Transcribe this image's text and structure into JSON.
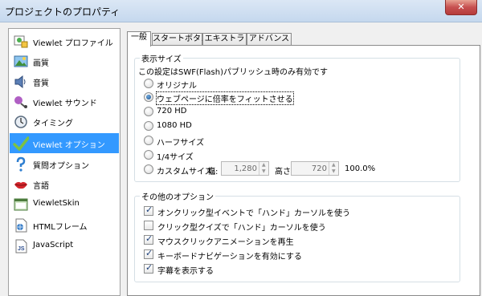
{
  "window": {
    "title": "プロジェクトのプロパティ",
    "close_glyph": "✕"
  },
  "sidebar": {
    "items": [
      {
        "label": "Viewlet プロファイル",
        "icon": "viewlet-profile-icon"
      },
      {
        "label": "画質",
        "icon": "image-quality-icon"
      },
      {
        "label": "音質",
        "icon": "speaker-icon"
      },
      {
        "label": "Viewlet サウンド",
        "icon": "viewlet-sound-icon"
      },
      {
        "label": "タイミング",
        "icon": "clock-icon"
      },
      {
        "label": "Viewlet オプション",
        "icon": "checkmark-icon",
        "selected": true
      },
      {
        "label": "質問オプション",
        "icon": "question-mark-icon"
      },
      {
        "label": "言語",
        "icon": "lips-icon"
      },
      {
        "label": "ViewletSkin",
        "icon": "skin-window-icon"
      },
      {
        "label": "HTMLフレーム",
        "icon": "html-page-icon"
      },
      {
        "label": "JavaScript",
        "icon": "javascript-icon"
      }
    ]
  },
  "tabs": [
    {
      "label": "一般",
      "active": true
    },
    {
      "label": "スタートボタン"
    },
    {
      "label": "エキストラ"
    },
    {
      "label": "アドバンス"
    }
  ],
  "display_size": {
    "legend": "表示サイズ",
    "note": "この設定はSWF(Flash)パブリッシュ時のみ有効です",
    "options": [
      {
        "label": "オリジナル",
        "checked": false
      },
      {
        "label": "ウェブページに倍率をフィットさせる",
        "checked": true
      },
      {
        "label": "720 HD",
        "checked": false
      },
      {
        "label": "1080 HD",
        "checked": false
      },
      {
        "label": "ハーフサイズ",
        "checked": false
      },
      {
        "label": "1/4サイズ",
        "checked": false
      },
      {
        "label": "カスタムサイズ:",
        "checked": false
      }
    ],
    "width_label": "幅:",
    "width_value": "1,280",
    "height_label": "高さ:",
    "height_value": "720",
    "percent": "100.0%"
  },
  "other_options": {
    "legend": "その他のオプション",
    "options": [
      {
        "label": "オンクリック型イベントで「ハンド」カーソルを使う",
        "checked": true
      },
      {
        "label": "クリック型クイズで「ハンド」カーソルを使う",
        "checked": false
      },
      {
        "label": "マウスクリックアニメーションを再生",
        "checked": true
      },
      {
        "label": "キーボードナビゲーションを有効にする",
        "checked": true
      },
      {
        "label": "字幕を表示する",
        "checked": true
      }
    ]
  }
}
